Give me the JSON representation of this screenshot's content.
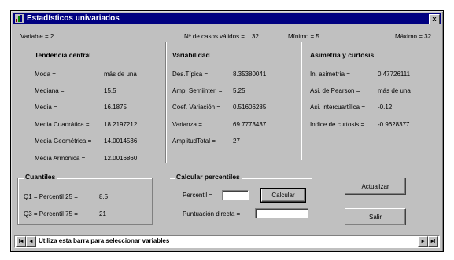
{
  "window": {
    "title": "Estadísticos univariados",
    "close_glyph": "x"
  },
  "top": {
    "variable": "Variable = 2",
    "n_valid": "Nº de casos válidos =",
    "n_valid_value": "32",
    "min": "Mínimo = 5",
    "max": "Máximo = 32"
  },
  "central": {
    "header": "Tendencia central",
    "rows": [
      {
        "label": "Moda =",
        "value": "más de una"
      },
      {
        "label": "Mediana =",
        "value": "15.5"
      },
      {
        "label": "Media =",
        "value": "16.1875"
      },
      {
        "label": "Media Cuadrática =",
        "value": "18.2197212"
      },
      {
        "label": "Media Geométrica =",
        "value": "14.0014536"
      },
      {
        "label": "Media Armónica =",
        "value": "12.0016860"
      }
    ]
  },
  "variability": {
    "header": "Variabilidad",
    "rows": [
      {
        "label": "Des.Típica =",
        "value": "8.35380041"
      },
      {
        "label": "Amp. Semiinter. =",
        "value": "5.25"
      },
      {
        "label": "Coef. Variación =",
        "value": "0.51606285"
      },
      {
        "label": "Varianza =",
        "value": "69.7773437"
      },
      {
        "label": "AmplitudTotal =",
        "value": "27"
      }
    ]
  },
  "asymmetry": {
    "header": "Asimetría y curtosis",
    "rows": [
      {
        "label": "In. asimetría =",
        "value": "0.47726111"
      },
      {
        "label": "Asi. de Pearson =",
        "value": "más de una"
      },
      {
        "label": "Asi. intercuartílica =",
        "value": "-0.12"
      },
      {
        "label": "Indice de curtosis =",
        "value": "-0.9628377"
      }
    ]
  },
  "quantiles": {
    "header": "Cuantiles",
    "q1": "Q1 = Percentil 25 =",
    "q1_value": "8.5",
    "q3": "Q3 = Percentil 75 =",
    "q3_value": "21"
  },
  "percentile_calc": {
    "header": "Calcular percentiles",
    "percentil_label": "Percentil =",
    "percentil_value": "",
    "calc_button": "Calcular",
    "direct_label": "Puntuación directa =",
    "direct_value": ""
  },
  "buttons": {
    "update": "Actualizar",
    "exit": "Salir"
  },
  "nav": {
    "first": "I◂",
    "prev": "◂",
    "next": "▸",
    "last": "▸I",
    "status": "Utiliza esta barra para seleccionar variables"
  }
}
